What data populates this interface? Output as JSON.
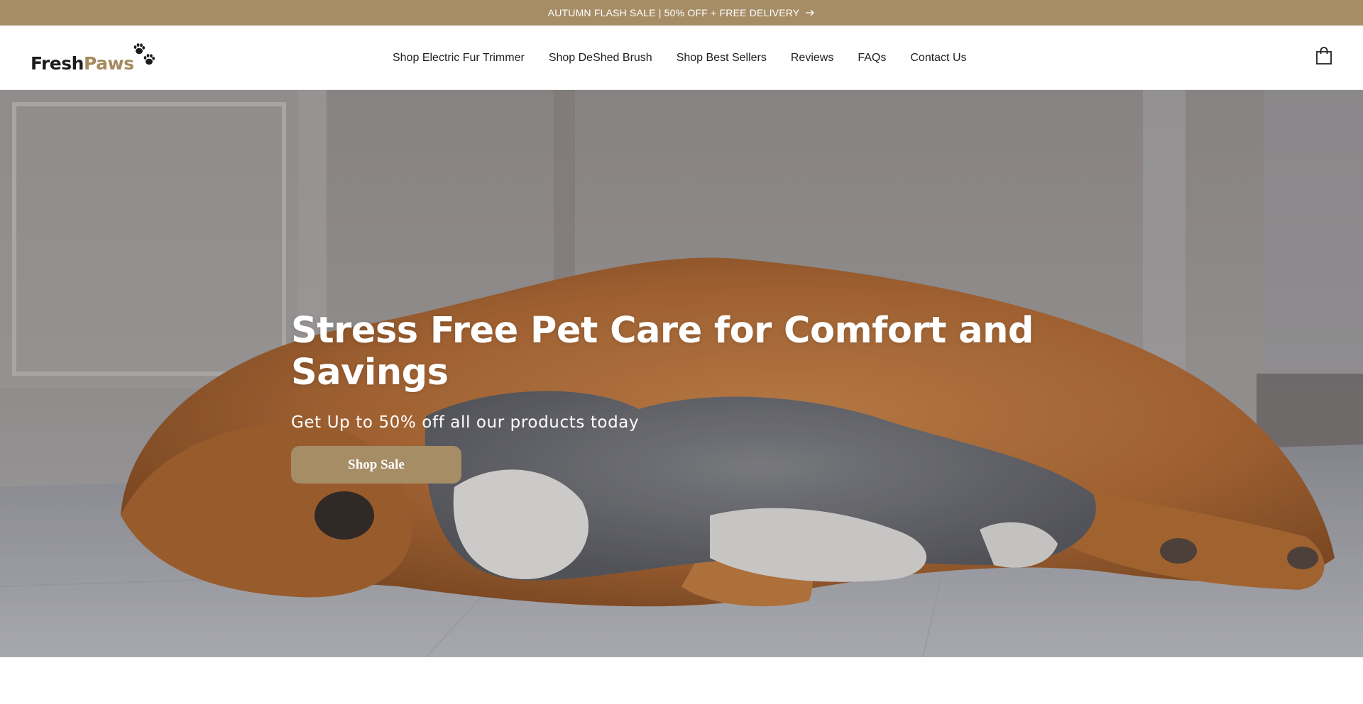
{
  "announcement": {
    "text": "AUTUMN FLASH SALE | 50% OFF + FREE DELIVERY",
    "arrow_icon": "arrow-right-icon"
  },
  "header": {
    "logo": {
      "part1": "Fresh",
      "part2": "Paws",
      "icon": "paw-prints-icon"
    },
    "nav": [
      {
        "label": "Shop Electric Fur Trimmer"
      },
      {
        "label": "Shop DeShed Brush"
      },
      {
        "label": "Shop Best Sellers"
      },
      {
        "label": "Reviews"
      },
      {
        "label": "FAQs"
      },
      {
        "label": "Contact Us"
      }
    ],
    "cart_icon": "shopping-bag-icon"
  },
  "hero": {
    "title": "Stress Free Pet Care for Comfort and Savings",
    "subtitle": "Get Up to 50% off all our products today",
    "button_label": "Shop Sale",
    "image": "golden retriever and grey-white kitten sleeping together on a tiled floor"
  },
  "colors": {
    "accent": "#a68d66",
    "logo_brown": "#a68a5e",
    "text_dark": "#1f1f1f"
  }
}
